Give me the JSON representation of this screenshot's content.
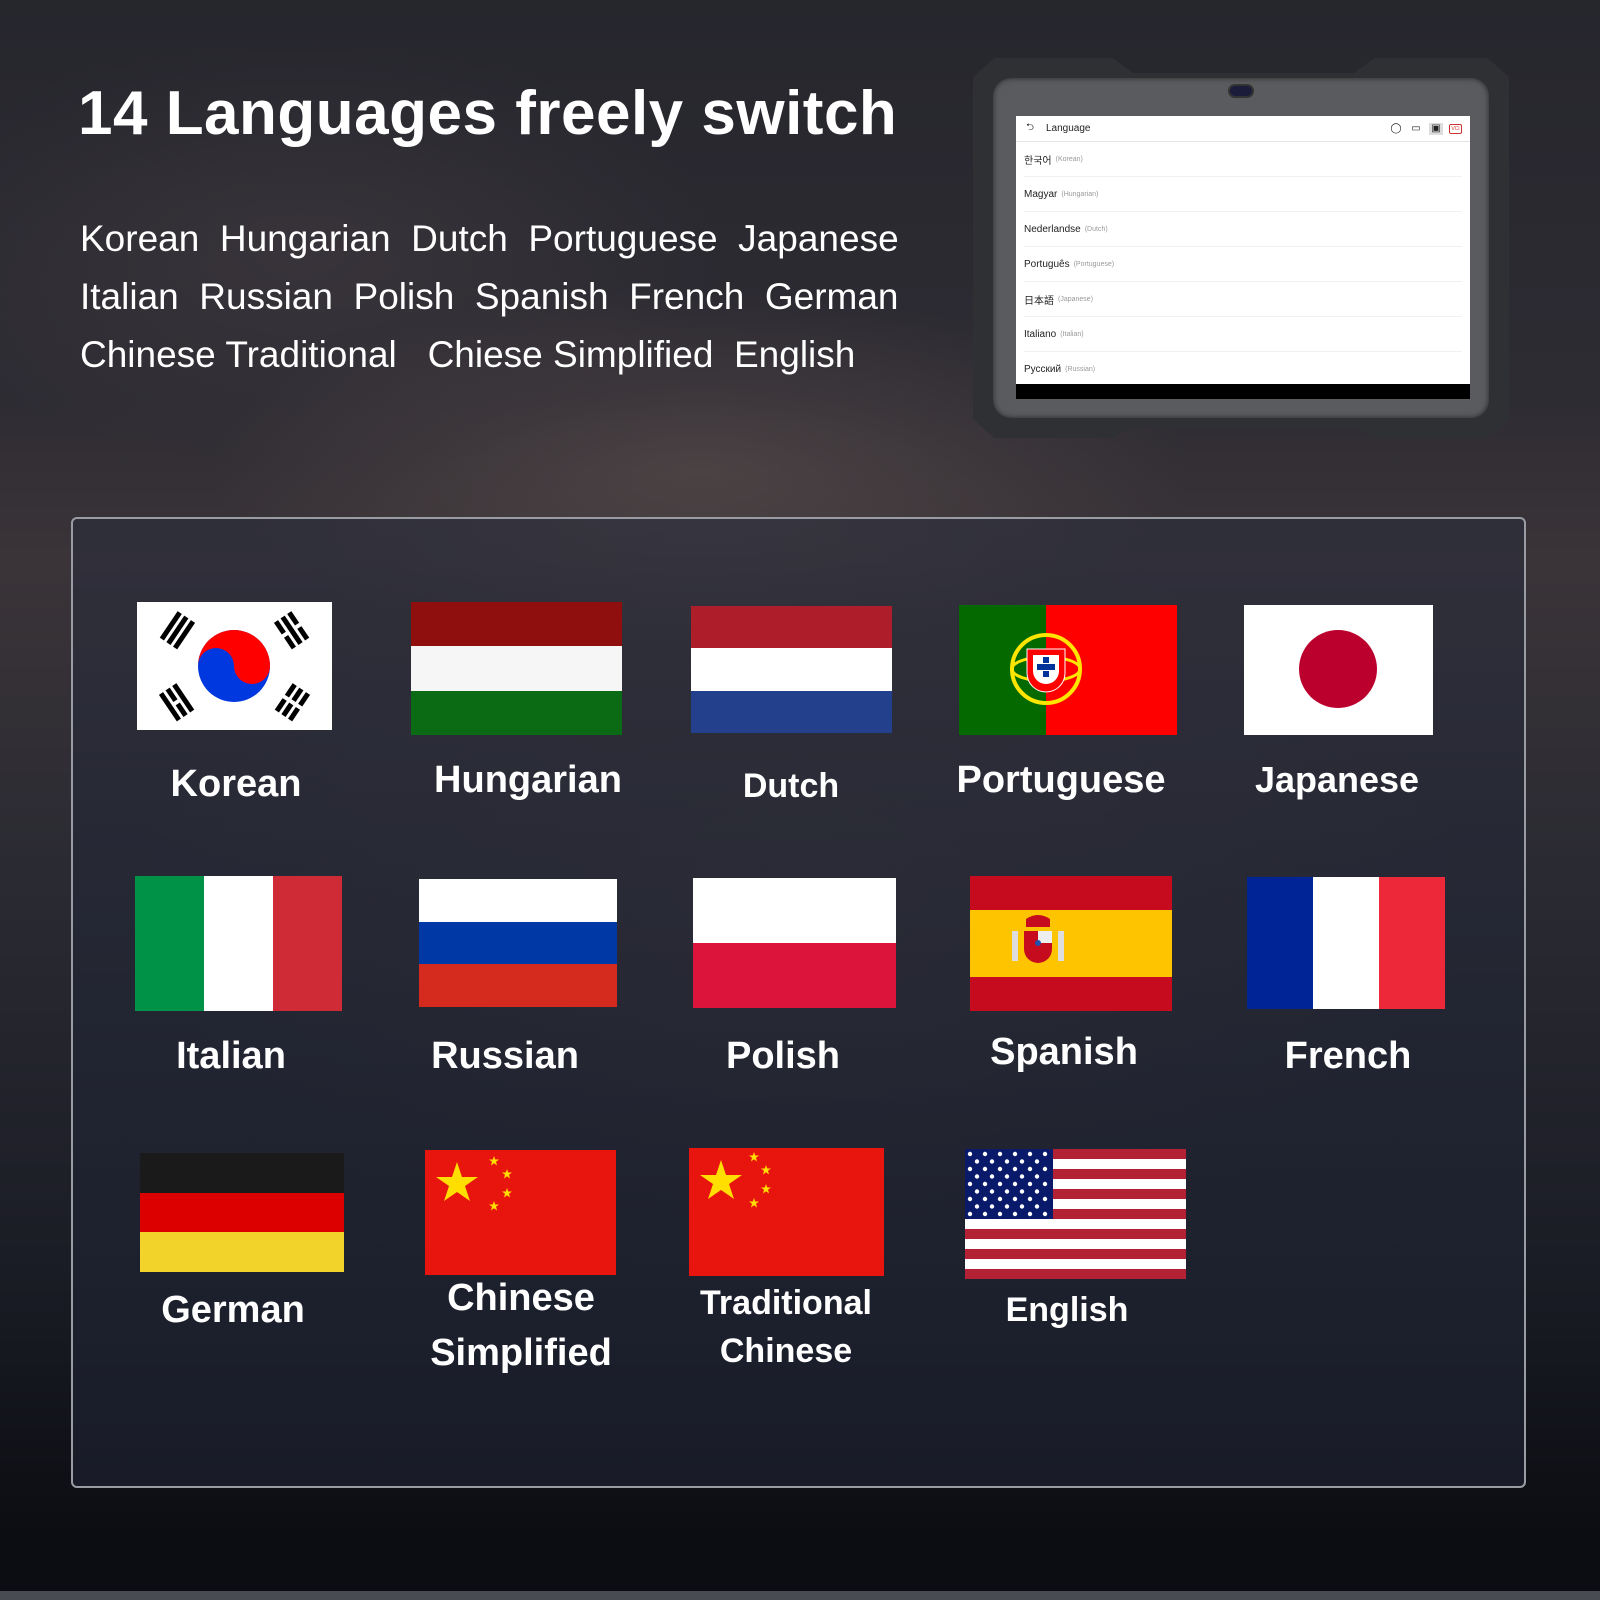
{
  "headline": "14 Languages freely switch",
  "language_lines": [
    "Korean  Hungarian  Dutch  Portuguese  Japanese",
    "Italian  Russian  Polish  Spanish  French  German",
    "Chinese Traditional   Chiese Simplified  English"
  ],
  "tablet": {
    "screen_title": "Language",
    "back_icon": "back-arrow-icon",
    "toolbar_icons": [
      "refresh-icon",
      "video-icon",
      "screenshot-icon",
      "vci-icon"
    ],
    "vci_label": "VCI",
    "languages": [
      {
        "native": "한국어",
        "english": "(Korean)"
      },
      {
        "native": "Magyar",
        "english": "(Hungarian)"
      },
      {
        "native": "Nederlandse",
        "english": "(Dutch)"
      },
      {
        "native": "Português",
        "english": "(Portuguese)"
      },
      {
        "native": "日本語",
        "english": "(Japanese)"
      },
      {
        "native": "Italiano",
        "english": "(Italian)"
      },
      {
        "native": "Русский",
        "english": "(Russian)"
      }
    ]
  },
  "flags": [
    {
      "id": "korean",
      "label": "Korean"
    },
    {
      "id": "hungarian",
      "label": "Hungarian",
      "colors": [
        "#8f0e0e",
        "#f6f6f6",
        "#0b6b14"
      ]
    },
    {
      "id": "dutch",
      "label": "Dutch",
      "colors": [
        "#ad1d2a",
        "#ffffff",
        "#22408c"
      ]
    },
    {
      "id": "portuguese",
      "label": "Portuguese",
      "colors": [
        "#046a00",
        "#ff0000"
      ]
    },
    {
      "id": "japanese",
      "label": "Japanese",
      "colors": [
        "#ffffff",
        "#bc002d"
      ]
    },
    {
      "id": "italian",
      "label": "Italian",
      "colors": [
        "#009246",
        "#ffffff",
        "#ce2b37"
      ]
    },
    {
      "id": "russian",
      "label": "Russian",
      "colors": [
        "#ffffff",
        "#0039a6",
        "#d52b1e"
      ]
    },
    {
      "id": "polish",
      "label": "Polish",
      "colors": [
        "#ffffff",
        "#dc143c"
      ]
    },
    {
      "id": "spanish",
      "label": "Spanish",
      "colors": [
        "#c60b1e",
        "#ffc400",
        "#c60b1e"
      ]
    },
    {
      "id": "french",
      "label": "French",
      "colors": [
        "#002395",
        "#ffffff",
        "#ed2939"
      ]
    },
    {
      "id": "german",
      "label": "German",
      "colors": [
        "#1a1a1a",
        "#dd0000",
        "#f2d32a"
      ]
    },
    {
      "id": "chinese-simplified",
      "label_lines": [
        "Chinese",
        "Simplified"
      ],
      "colors": [
        "#e8140e",
        "#ffde00"
      ]
    },
    {
      "id": "traditional-chinese",
      "label_lines": [
        "Traditional",
        "Chinese"
      ],
      "colors": [
        "#e8140e",
        "#ffde00"
      ]
    },
    {
      "id": "english",
      "label": "English",
      "colors": [
        "#b22234",
        "#ffffff",
        "#0a1a6b"
      ]
    }
  ]
}
